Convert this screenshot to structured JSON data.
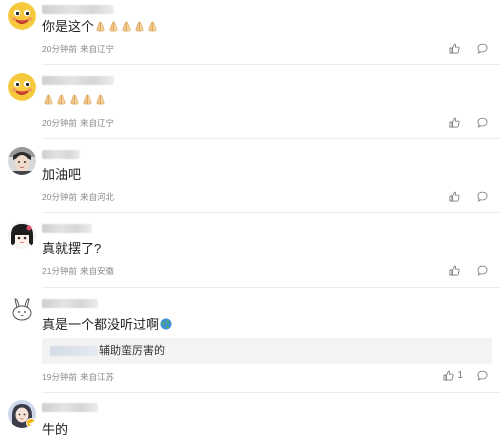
{
  "comments": [
    {
      "text": "你是这个",
      "time": "20分钟前",
      "location": "来自辽宁",
      "likes": "",
      "avatar": "yellow-face-avatar"
    },
    {
      "text": "",
      "time": "20分钟前",
      "location": "来自辽宁",
      "likes": "",
      "avatar": "yellow-face-avatar"
    },
    {
      "text": "加油吧",
      "time": "20分钟前",
      "location": "来自河北",
      "likes": "",
      "avatar": "person-photo-avatar"
    },
    {
      "text": "真就摆了?",
      "time": "21分钟前",
      "location": "来自安徽",
      "likes": "",
      "avatar": "anime-girl-avatar"
    },
    {
      "text": "真是一个都没听过啊",
      "time": "19分钟前",
      "location": "来自江苏",
      "likes": "1",
      "avatar": "bunny-sketch-avatar",
      "reply": {
        "text": "辅助蛮厉害的"
      }
    },
    {
      "text": "牛的",
      "time": "",
      "location": "",
      "likes": "",
      "avatar": "girl-photo-avatar"
    }
  ],
  "icons": {
    "like": "thumbs-up-icon",
    "reply": "comment-bubble-icon",
    "emoji": "praying-hands-icon"
  },
  "colors": {
    "meta": "#8a8a8a",
    "divider": "#ececec",
    "reply_bg": "#f3f3f3"
  }
}
